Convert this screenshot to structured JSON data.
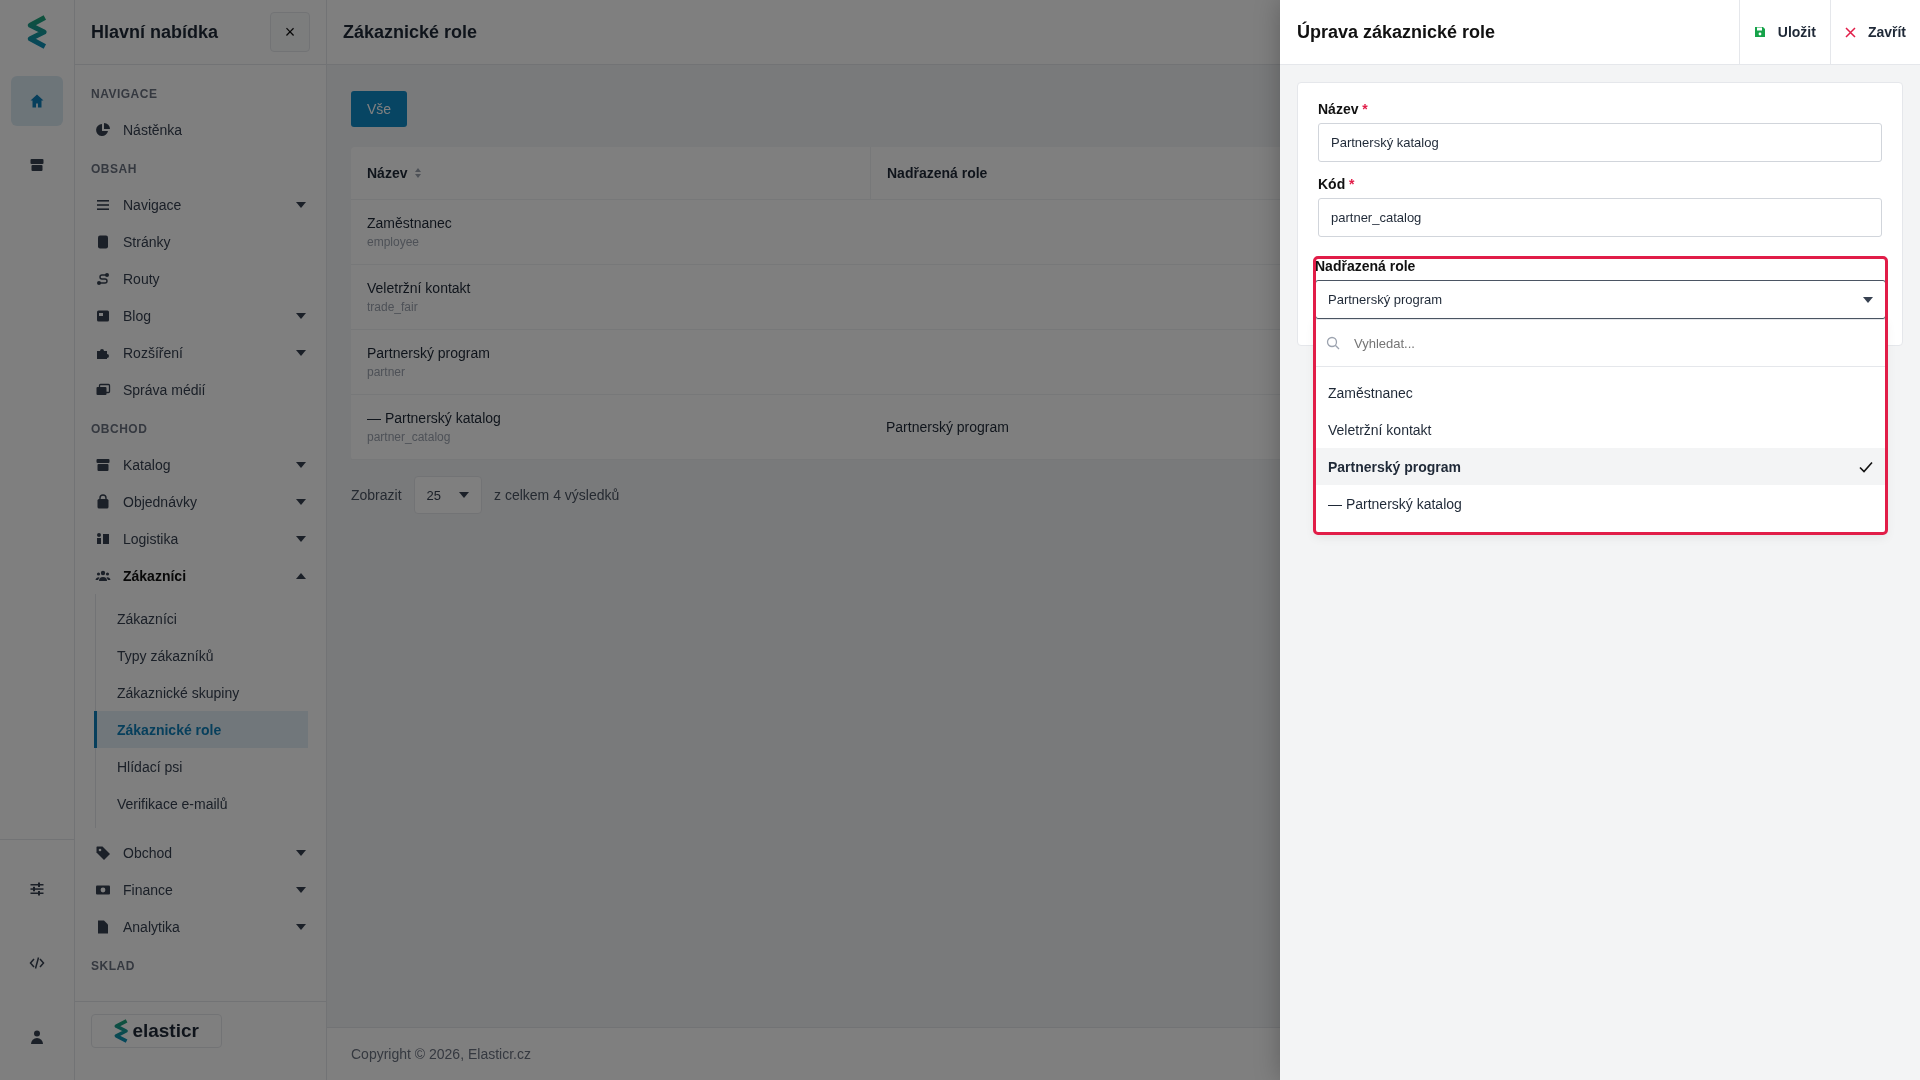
{
  "rail": {
    "items": [
      {
        "selected": true
      },
      {
        "selected": false
      }
    ],
    "bottom_items": [
      {
        "selected": false
      },
      {
        "selected": false
      },
      {
        "selected": false
      }
    ]
  },
  "sidebar": {
    "title": "Hlavní nabídka",
    "close": "×",
    "sections": [
      {
        "heading": "NAVIGACE",
        "items": [
          {
            "kind": "link",
            "label": "Nástěnka"
          }
        ]
      },
      {
        "heading": "OBSAH",
        "items": [
          {
            "kind": "group",
            "label": "Navigace",
            "expanded": false
          },
          {
            "kind": "link",
            "label": "Stránky"
          },
          {
            "kind": "link",
            "label": "Routy"
          },
          {
            "kind": "group",
            "label": "Blog",
            "expanded": false
          },
          {
            "kind": "group",
            "label": "Rozšíření",
            "expanded": false
          },
          {
            "kind": "link",
            "label": "Správa médií"
          }
        ]
      },
      {
        "heading": "OBCHOD",
        "items": [
          {
            "kind": "group",
            "label": "Katalog",
            "expanded": false
          },
          {
            "kind": "group",
            "label": "Objednávky",
            "expanded": false
          },
          {
            "kind": "group",
            "label": "Logistika",
            "expanded": false
          },
          {
            "kind": "group",
            "label": "Zákazníci",
            "expanded": true,
            "children": [
              {
                "label": "Zákazníci",
                "selected": false
              },
              {
                "label": "Typy zákazníků",
                "selected": false
              },
              {
                "label": "Zákaznické skupiny",
                "selected": false
              },
              {
                "label": "Zákaznické role",
                "selected": true
              },
              {
                "label": "Hlídací psi",
                "selected": false
              },
              {
                "label": "Verifikace e-mailů",
                "selected": false
              }
            ]
          },
          {
            "kind": "group",
            "label": "Obchod",
            "expanded": false
          },
          {
            "kind": "group",
            "label": "Finance",
            "expanded": false
          },
          {
            "kind": "group",
            "label": "Analytika",
            "expanded": false
          }
        ]
      },
      {
        "heading": "SKLAD"
      }
    ],
    "brand": "elasticr"
  },
  "main": {
    "title": "Zákaznické role",
    "filter": "Vše",
    "table": {
      "columns": [
        {
          "label": "Název",
          "sortable": true
        },
        {
          "label": "Nadřazená role",
          "sortable": false
        }
      ],
      "rows": [
        {
          "name": "Zaměstnanec",
          "code": "employee"
        },
        {
          "name": "Veletržní kontakt",
          "code": "trade_fair"
        },
        {
          "name": "Partnerský program",
          "code": "partner"
        },
        {
          "name": "— Partnerský katalog",
          "code": "partner_catalog",
          "parent": "Partnerský program"
        }
      ]
    },
    "pagination": {
      "label": "Zobrazit",
      "page_size": "25",
      "total": "z celkem 4 výsledků"
    },
    "footer": "Copyright © 2026, Elasticr.cz"
  },
  "panel": {
    "title": "Úprava zákaznické role",
    "actions": [
      {
        "kind": "save",
        "label": "Uložit"
      },
      {
        "kind": "close",
        "label": "Zavřít"
      }
    ],
    "fields": [
      {
        "label": "Název",
        "required_mark": "*",
        "value": "Partnerský katalog"
      },
      {
        "label": "Kód",
        "required_mark": "*",
        "value": "partner_catalog"
      }
    ],
    "select": {
      "label": "Nadřazená role",
      "value": "Partnerský program",
      "focused": true,
      "open": true,
      "search_placeholder": "Vyhledat...",
      "options": [
        {
          "label": "Zaměstnanec",
          "selected": false
        },
        {
          "label": "Veletržní kontakt",
          "selected": false
        },
        {
          "label": "Partnerský program",
          "selected": true
        },
        {
          "label": "— Partnerský katalog",
          "selected": false
        }
      ]
    }
  }
}
